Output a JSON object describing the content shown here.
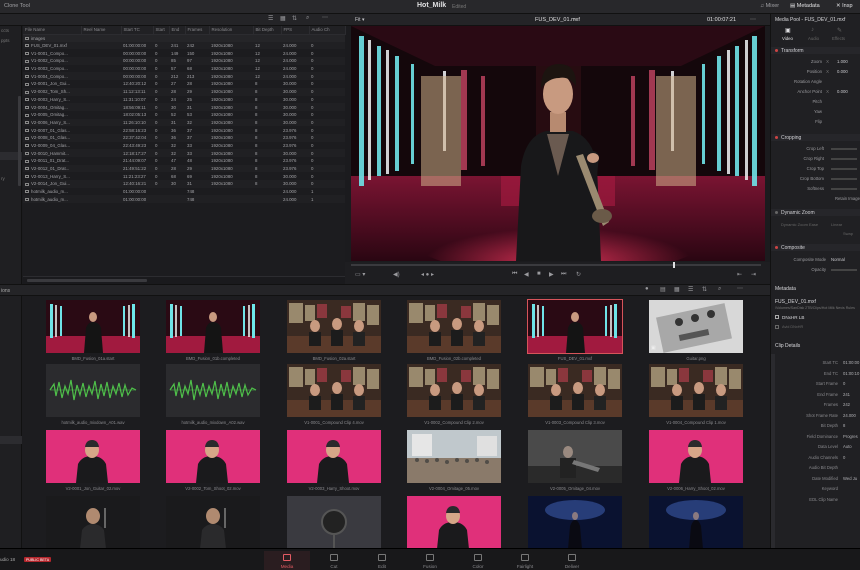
{
  "app": {
    "clone_tool": "Clone Tool",
    "project_title": "Hot_Milk",
    "project_status": "Edited",
    "version_label": "udio 18",
    "beta_badge": "PUBLIC BETA"
  },
  "top_right_tabs": [
    {
      "label": "Mixer",
      "icon": "music-note-icon"
    },
    {
      "label": "Metadata",
      "icon": "metadata-icon"
    },
    {
      "label": "Insp",
      "icon": "inspector-icon"
    }
  ],
  "viewer": {
    "fit_label": "Fit",
    "clip_name": "FUS_DEV_01.mxf",
    "timecode": "01:00:07:21"
  },
  "left_side": {
    "items": [
      "ccts",
      "ppts",
      "ry"
    ],
    "pool_label": "ions"
  },
  "media_table": {
    "columns": [
      "File Name",
      "Reel Name",
      "Start TC",
      "Start",
      "End",
      "Frames",
      "Resolution",
      "Bit Depth",
      "FPS",
      "Audio Ch"
    ],
    "rows": [
      [
        "images",
        "",
        "",
        "",
        "",
        "",
        "",
        "",
        "",
        ""
      ],
      [
        "FUS_DEV_01.mxf",
        "",
        "01:00:00:00",
        "0",
        "241",
        "242",
        "1920x1080",
        "12",
        "24.000",
        "0"
      ],
      [
        "V1-0001_Compo...",
        "",
        "00:00:00:00",
        "0",
        "149",
        "150",
        "1920x1080",
        "12",
        "24.000",
        "0"
      ],
      [
        "V1-0002_Compo...",
        "",
        "00:00:00:00",
        "0",
        "85",
        "97",
        "1920x1080",
        "12",
        "24.000",
        "0"
      ],
      [
        "V1-0003_Compo...",
        "",
        "00:00:00:00",
        "0",
        "57",
        "68",
        "1920x1080",
        "12",
        "24.000",
        "0"
      ],
      [
        "V1-0004_Compo...",
        "",
        "00:00:00:00",
        "0",
        "212",
        "213",
        "1920x1080",
        "12",
        "24.000",
        "0"
      ],
      [
        "V2-0001_Jon_Gui...",
        "",
        "12:40:20:12",
        "0",
        "27",
        "28",
        "1920x1080",
        "8",
        "30.000",
        "0"
      ],
      [
        "V2-0002_Tom_Sh...",
        "",
        "11:12:13:11",
        "0",
        "28",
        "29",
        "1920x1080",
        "8",
        "30.000",
        "0"
      ],
      [
        "V2-0003_Harry_S...",
        "",
        "11:31:10:07",
        "0",
        "24",
        "25",
        "1920x1080",
        "8",
        "30.000",
        "0"
      ],
      [
        "V2-0004_Omitag...",
        "",
        "18:56:09:11",
        "0",
        "30",
        "31",
        "1920x1080",
        "8",
        "30.000",
        "0"
      ],
      [
        "V2-0005_Omitag...",
        "",
        "18:02:05:13",
        "0",
        "52",
        "53",
        "1920x1080",
        "8",
        "30.000",
        "0"
      ],
      [
        "V2-0006_Harry_S...",
        "",
        "11:26:10:10",
        "0",
        "31",
        "32",
        "1920x1080",
        "8",
        "30.000",
        "0"
      ],
      [
        "V2-0007_01_Glas...",
        "",
        "22:58:16:23",
        "0",
        "36",
        "37",
        "1920x1080",
        "8",
        "23.976",
        "0"
      ],
      [
        "V2-0008_01_Glas...",
        "",
        "22:37:42:04",
        "0",
        "36",
        "37",
        "1920x1080",
        "8",
        "23.976",
        "0"
      ],
      [
        "V2-0009_04_Glas...",
        "",
        "22:43:49:23",
        "0",
        "32",
        "33",
        "1920x1080",
        "8",
        "23.976",
        "0"
      ],
      [
        "V2-0010_Hammit...",
        "",
        "12:18:17:27",
        "0",
        "32",
        "33",
        "1920x1080",
        "8",
        "30.000",
        "0"
      ],
      [
        "V2-0011_01_Drat...",
        "",
        "21:44:09:07",
        "0",
        "47",
        "48",
        "1920x1080",
        "8",
        "23.976",
        "0"
      ],
      [
        "V2-0012_01_Drat...",
        "",
        "21:49:51:22",
        "0",
        "28",
        "29",
        "1920x1080",
        "8",
        "23.976",
        "0"
      ],
      [
        "V2-0013_Harry_S...",
        "",
        "11:21:23:27",
        "0",
        "68",
        "69",
        "1920x1080",
        "8",
        "30.000",
        "0"
      ],
      [
        "V2-0014_Jon_Gui...",
        "",
        "12:40:16:21",
        "0",
        "30",
        "31",
        "1920x1080",
        "8",
        "30.000",
        "0"
      ],
      [
        "hotmilk_audio_m...",
        "",
        "01:00:00:00",
        "",
        "",
        "748",
        "",
        "",
        "24.000",
        "1"
      ],
      [
        "hotmilk_audio_m...",
        "",
        "01:00:00:00",
        "",
        "",
        "748",
        "",
        "",
        "24.000",
        "1"
      ]
    ]
  },
  "inspector": {
    "title": "Media Pool - FUS_DEV_01.mxf",
    "tabs": [
      "Video",
      "Audio",
      "Effects"
    ],
    "transform_header": "Transform",
    "transform_rows": [
      {
        "label": "Zoom",
        "axis": "X",
        "value": "1.000"
      },
      {
        "label": "Position",
        "axis": "X",
        "value": "0.000"
      },
      {
        "label": "Rotation Angle",
        "axis": "",
        "value": ""
      },
      {
        "label": "Anchor Point",
        "axis": "X",
        "value": "0.000"
      },
      {
        "label": "Pitch",
        "axis": "",
        "value": ""
      },
      {
        "label": "Yaw",
        "axis": "",
        "value": ""
      },
      {
        "label": "Flip",
        "axis": "",
        "value": ""
      }
    ],
    "cropping_header": "Cropping",
    "cropping_rows": [
      "Crop Left",
      "Crop Right",
      "Crop Top",
      "Crop Bottom",
      "Softness"
    ],
    "retain_label": "Retain Image",
    "dynamic_zoom_header": "Dynamic Zoom",
    "dynamic_zoom_row": "Dynamic Zoom Ease",
    "dynamic_zoom_value": "Linear",
    "swap_label": "Swap",
    "composite_header": "Composite",
    "composite_rows": [
      {
        "label": "Composite Mode",
        "value": "Normal"
      },
      {
        "label": "Opacity",
        "value": ""
      }
    ]
  },
  "media_pool": {
    "clips": [
      {
        "name": "BMD_Fusion_01a.start",
        "kind": "stage",
        "selected": false
      },
      {
        "name": "BMD_Fusion_01b.completed",
        "kind": "stage",
        "selected": false
      },
      {
        "name": "BMD_Fusion_02a.start",
        "kind": "band",
        "selected": false
      },
      {
        "name": "BMD_Fusion_02b.completed",
        "kind": "band",
        "selected": false
      },
      {
        "name": "FUS_DEV_01.mxf",
        "kind": "stage",
        "selected": true
      },
      {
        "name": "Guitar.png",
        "kind": "pedal",
        "selected": false
      },
      {
        "name": "hotmilk_audio_mixdown_A01.wav",
        "kind": "audio",
        "selected": false
      },
      {
        "name": "hotmilk_audio_mixdown_A02.wav",
        "kind": "audio",
        "selected": false
      },
      {
        "name": "V1-0001_Compound Clip 4.mov",
        "kind": "band",
        "selected": false
      },
      {
        "name": "V1-0002_Compound Clip 2.mov",
        "kind": "band",
        "selected": false
      },
      {
        "name": "V1-0003_Compound Clip 3.mov",
        "kind": "band",
        "selected": false
      },
      {
        "name": "V1-0004_Compound Clip 1.mov",
        "kind": "band",
        "selected": false
      },
      {
        "name": "V2-0001_Jon_Guitar_02.mov",
        "kind": "pink",
        "selected": false
      },
      {
        "name": "V2-0002_Tom_Shoot_02.mov",
        "kind": "pink",
        "selected": false
      },
      {
        "name": "V2-0003_Harry_Shoot.mov",
        "kind": "pink",
        "selected": false
      },
      {
        "name": "V2-0004_Omitage_05.mov",
        "kind": "crowd",
        "selected": false
      },
      {
        "name": "V2-0005_Omitage_04.mov",
        "kind": "gray",
        "selected": false
      },
      {
        "name": "V2-0006_Harry_Shoot_02.mov",
        "kind": "pink",
        "selected": false
      },
      {
        "name": "",
        "kind": "dark",
        "selected": false
      },
      {
        "name": "",
        "kind": "dark",
        "selected": false
      },
      {
        "name": "",
        "kind": "mic",
        "selected": false
      },
      {
        "name": "",
        "kind": "pink",
        "selected": false
      },
      {
        "name": "",
        "kind": "concert",
        "selected": false
      },
      {
        "name": "",
        "kind": "concert",
        "selected": false
      }
    ]
  },
  "metadata": {
    "header": "Metadata",
    "file_name": "FUS_DEV_01.mxf",
    "file_path": "/Volumes/SanDisk 2TB/Clips/Hot Milk Nevis Rules",
    "codec": "DNxHR LB",
    "codec_sub": "Avid DNxHR",
    "section": "Clip Details",
    "rows": [
      {
        "label": "Start TC",
        "value": "01:00:00"
      },
      {
        "label": "End TC",
        "value": "01:00:10"
      },
      {
        "label": "Start Frame",
        "value": "0"
      },
      {
        "label": "End Frame",
        "value": "241"
      },
      {
        "label": "Frames",
        "value": "242"
      },
      {
        "label": "Shot Frame Rate",
        "value": "24.000"
      },
      {
        "label": "Bit Depth",
        "value": "8"
      },
      {
        "label": "Field Dominance",
        "value": "Progres"
      },
      {
        "label": "Data Level",
        "value": "Auto"
      },
      {
        "label": "Audio Channels",
        "value": "0"
      },
      {
        "label": "Audio Bit Depth",
        "value": ""
      },
      {
        "label": "Date Modified",
        "value": "Wed Ju"
      },
      {
        "label": "Keyword",
        "value": ""
      },
      {
        "label": "EDL Clip Name",
        "value": ""
      }
    ]
  },
  "pages": [
    {
      "label": "Media",
      "icon": "media-page-icon",
      "active": true
    },
    {
      "label": "Cut",
      "icon": "cut-page-icon",
      "active": false
    },
    {
      "label": "Edit",
      "icon": "edit-page-icon",
      "active": false
    },
    {
      "label": "Fusion",
      "icon": "fusion-page-icon",
      "active": false
    },
    {
      "label": "Color",
      "icon": "color-page-icon",
      "active": false
    },
    {
      "label": "Fairlight",
      "icon": "fairlight-page-icon",
      "active": false
    },
    {
      "label": "Deliver",
      "icon": "deliver-page-icon",
      "active": false
    }
  ],
  "colors": {
    "accent": "#e35b63",
    "panel": "#1c1c1f",
    "stage_pink": "#d8245e",
    "neon_cyan": "#6fe3e8"
  }
}
